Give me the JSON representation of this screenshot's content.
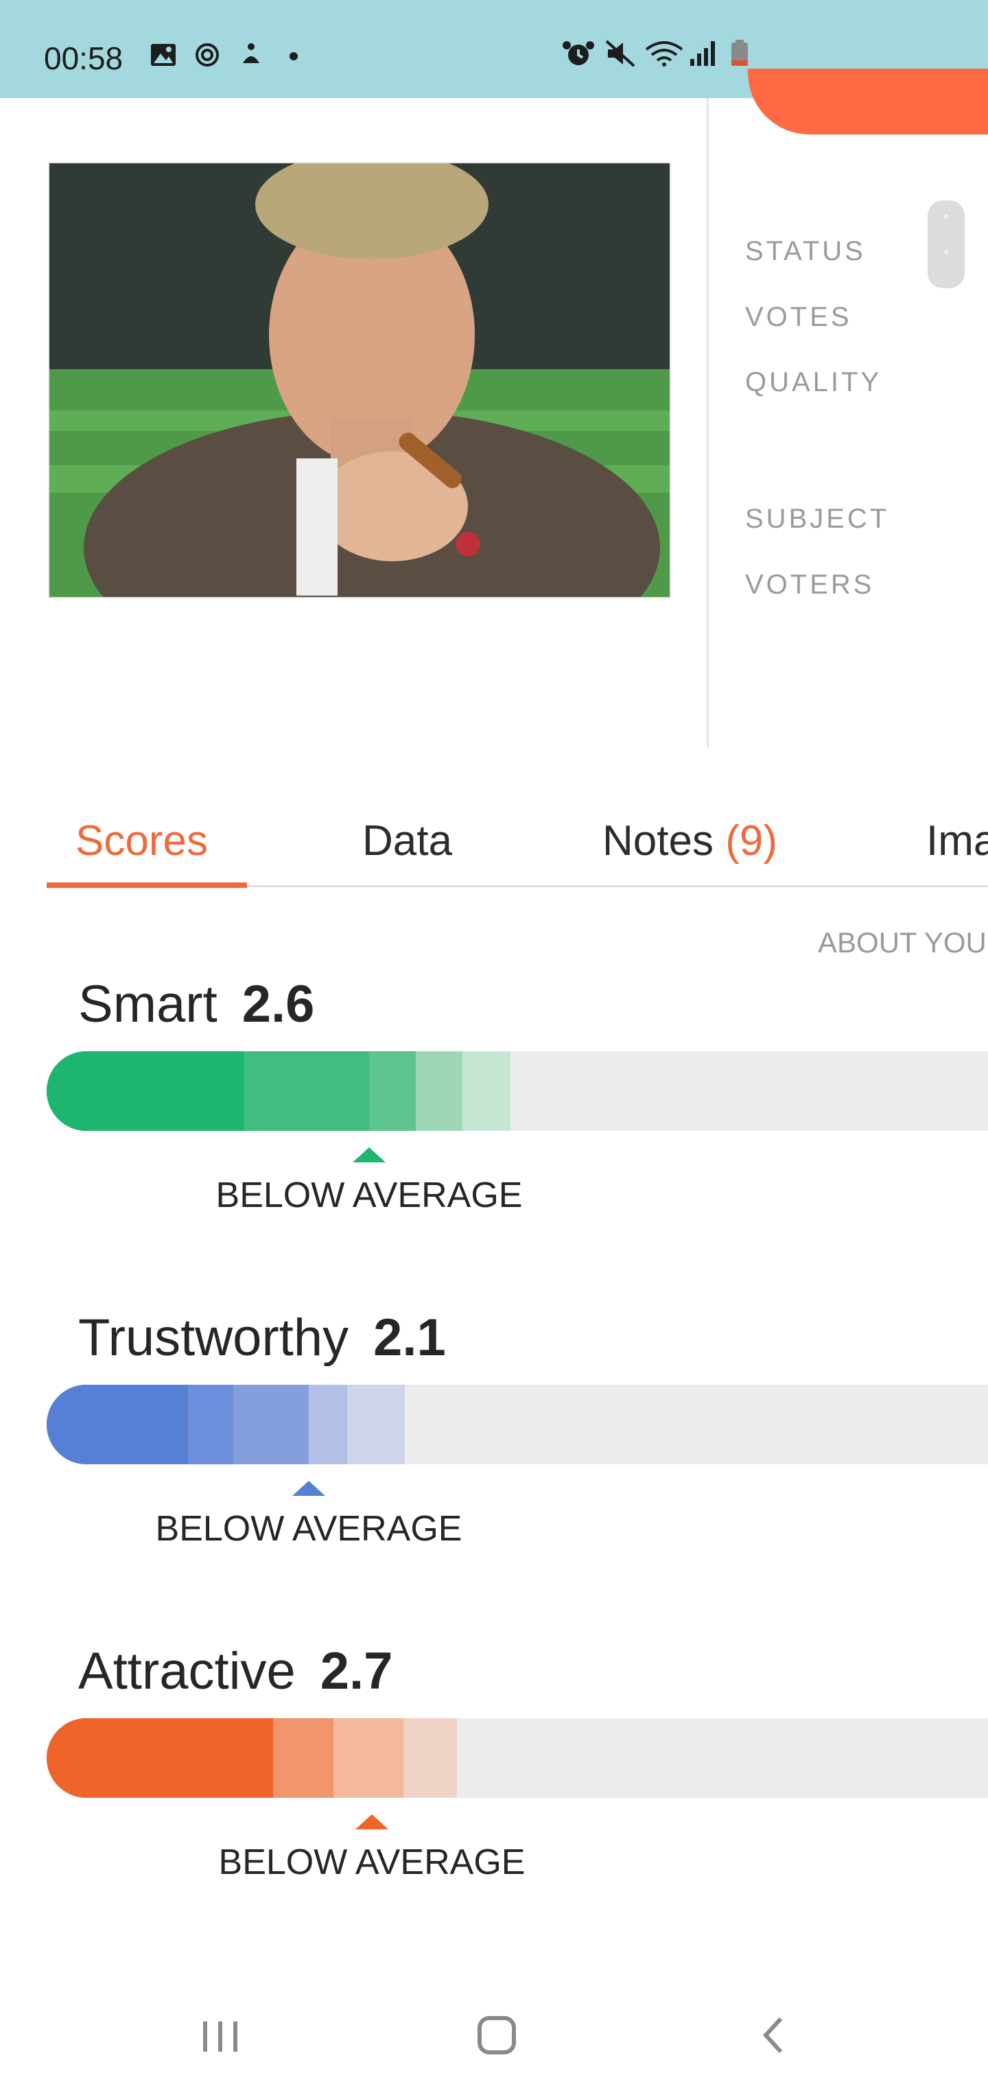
{
  "status_bar": {
    "time": "00:58",
    "left_icons": [
      "image-icon",
      "sync-icon",
      "accessibility-icon",
      "dot-icon"
    ],
    "right_icons": [
      "alarm-icon",
      "mute-icon",
      "wifi-icon",
      "signal-icon",
      "battery-low-icon"
    ]
  },
  "colors": {
    "accent": "#f0693d",
    "status_bar_bg": "#a3d8df",
    "smart": "#1db56f",
    "trustworthy": "#5580d6",
    "attractive": "#ef6428"
  },
  "details": {
    "labels": [
      "STATUS",
      "VOTES",
      "QUALITY",
      "SUBJECT",
      "VOTERS"
    ]
  },
  "tabs": [
    {
      "label": "Scores",
      "count": "",
      "active": true
    },
    {
      "label": "Data",
      "count": "",
      "active": false
    },
    {
      "label": "Notes ",
      "count": "(9)",
      "active": false
    },
    {
      "label": "Ima",
      "count": "",
      "active": false
    }
  ],
  "scores_header": "ABOUT YOU",
  "scores": [
    {
      "name": "Smart",
      "value": "2.6",
      "verdict": "BELOW AVERAGE"
    },
    {
      "name": "Trustworthy",
      "value": "2.1",
      "verdict": "BELOW AVERAGE"
    },
    {
      "name": "Attractive",
      "value": "2.7",
      "verdict": "BELOW AVERAGE"
    }
  ],
  "nav": [
    "recent-apps-icon",
    "home-icon",
    "back-icon"
  ]
}
